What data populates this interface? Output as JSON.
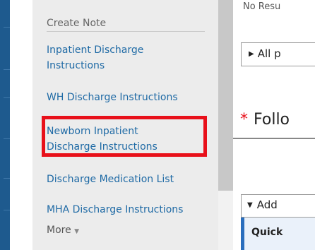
{
  "create_note": {
    "header": "Create Note",
    "links": [
      {
        "lines": [
          "Inpatient Discharge",
          "Instructions"
        ]
      },
      {
        "lines": [
          "WH Discharge Instructions"
        ]
      },
      {
        "lines": [
          "Newborn Inpatient",
          "Discharge Instructions"
        ]
      },
      {
        "lines": [
          "Discharge Medication List"
        ]
      },
      {
        "lines": [
          "MHA Discharge Instructions"
        ]
      }
    ],
    "more_label": "More",
    "more_caret": "▼"
  },
  "main": {
    "no_results_text": "No Resu",
    "all_button_label": "All p",
    "all_button_glyph": "▶",
    "section_required_marker": "*",
    "section_title": "Follo",
    "add_button_label": "Add",
    "add_button_glyph": "▼",
    "quick_label": "Quick"
  },
  "colors": {
    "link": "#1f6aa5",
    "highlight_border": "#e8101a",
    "left_bar": "#1e5a8e",
    "required": "#e8101a"
  }
}
